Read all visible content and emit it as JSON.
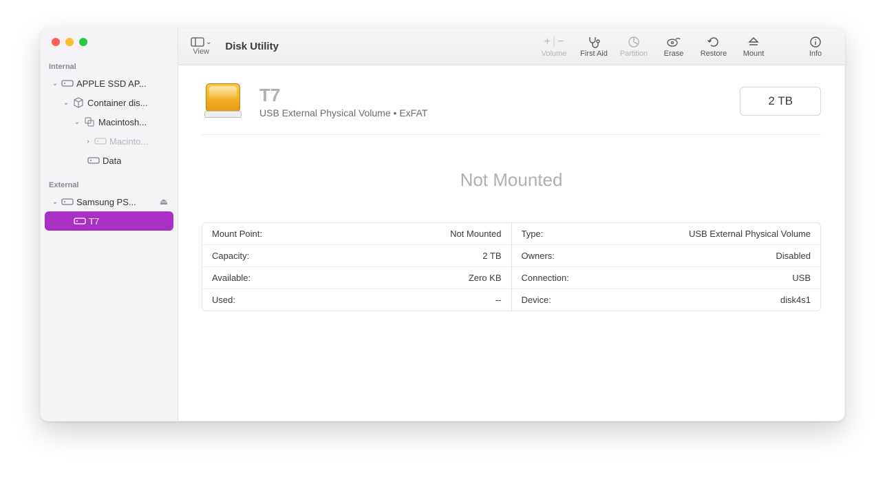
{
  "window": {
    "title": "Disk Utility"
  },
  "toolbar": {
    "view_label": "View",
    "buttons": {
      "volume": "Volume",
      "first_aid": "First Aid",
      "partition": "Partition",
      "erase": "Erase",
      "restore": "Restore",
      "mount": "Mount",
      "info": "Info"
    }
  },
  "sidebar": {
    "sections": {
      "internal_label": "Internal",
      "external_label": "External"
    },
    "internal": [
      {
        "label": "APPLE SSD AP..."
      },
      {
        "label": "Container dis..."
      },
      {
        "label": "Macintosh..."
      },
      {
        "label": "Macinto..."
      },
      {
        "label": "Data"
      }
    ],
    "external": [
      {
        "label": "Samsung PS..."
      },
      {
        "label": "T7"
      }
    ]
  },
  "volume": {
    "name": "T7",
    "subtitle": "USB External Physical Volume • ExFAT",
    "capacity_badge": "2 TB",
    "status": "Not Mounted"
  },
  "details": {
    "left": [
      {
        "k": "Mount Point:",
        "v": "Not Mounted"
      },
      {
        "k": "Capacity:",
        "v": "2 TB"
      },
      {
        "k": "Available:",
        "v": "Zero KB"
      },
      {
        "k": "Used:",
        "v": "--"
      }
    ],
    "right": [
      {
        "k": "Type:",
        "v": "USB External Physical Volume"
      },
      {
        "k": "Owners:",
        "v": "Disabled"
      },
      {
        "k": "Connection:",
        "v": "USB"
      },
      {
        "k": "Device:",
        "v": "disk4s1"
      }
    ]
  }
}
